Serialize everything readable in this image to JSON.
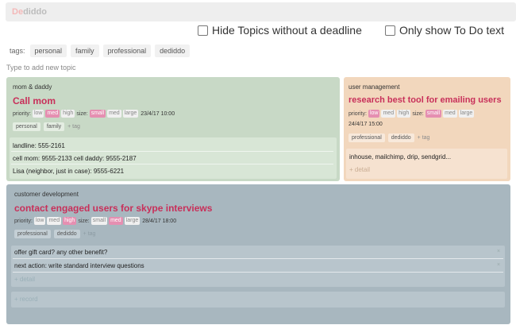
{
  "app": {
    "logo_part1": "De",
    "logo_part2": "diddo"
  },
  "filters": {
    "hide_no_deadline": "Hide Topics without a deadline",
    "only_todo": "Only show To Do text"
  },
  "tags": {
    "label": "tags:",
    "items": [
      "personal",
      "family",
      "professional",
      "dediddo"
    ]
  },
  "add_topic_placeholder": "Type to add new topic",
  "cards": [
    {
      "category": "mom & daddy",
      "title": "Call mom",
      "priority_label": "priority:",
      "priority_options": [
        "low",
        "med",
        "high"
      ],
      "priority_selected": "med",
      "size_label": "size:",
      "size_options": [
        "small",
        "med",
        "large"
      ],
      "size_selected": "small",
      "due": "23/4/17 10:00",
      "tags": [
        "personal",
        "family"
      ],
      "add_tag": "+ tag",
      "details": [
        "landline: 555-2161",
        "cell mom: 9555-2133 cell daddy: 9555-2187",
        "Lisa (neighbor, just in case): 9555-6221"
      ],
      "colors": {
        "bg": "#c8d9c6",
        "detail_bg": "#d8e6d6",
        "tag_bg": "#e4ede2"
      }
    },
    {
      "category": "user management",
      "title": "research best tool for emailing users",
      "priority_label": "priority:",
      "priority_options": [
        "low",
        "med",
        "high"
      ],
      "priority_selected": "low",
      "size_label": "size:",
      "size_options": [
        "small",
        "med",
        "large"
      ],
      "size_selected": "small",
      "due": "24/4/17 15:00",
      "tags": [
        "professional",
        "dediddo"
      ],
      "add_tag": "+ tag",
      "details": [
        "inhouse, mailchimp, drip, sendgrid..."
      ],
      "add_detail": "+ detail",
      "colors": {
        "bg": "#f2d7bd",
        "detail_bg": "#f6e2d0",
        "tag_bg": "#f8e9db"
      }
    },
    {
      "category": "customer development",
      "title": "contact engaged users for skype interviews",
      "priority_label": "priority:",
      "priority_options": [
        "low",
        "med",
        "high"
      ],
      "priority_selected": "high",
      "size_label": "size:",
      "size_options": [
        "small",
        "med",
        "large"
      ],
      "size_selected": "med",
      "due": "28/4/17 18:00",
      "tags": [
        "professional",
        "dediddo"
      ],
      "add_tag": "+ tag",
      "details": [
        "offer gift card? any other benefit?",
        "next action: write standard interview questions"
      ],
      "add_detail": "+ detail",
      "add_record": "+ record",
      "colors": {
        "bg": "#a8b7bf",
        "detail_bg": "#b8c5cc",
        "tag_bg": "#c4cfd5"
      }
    }
  ]
}
